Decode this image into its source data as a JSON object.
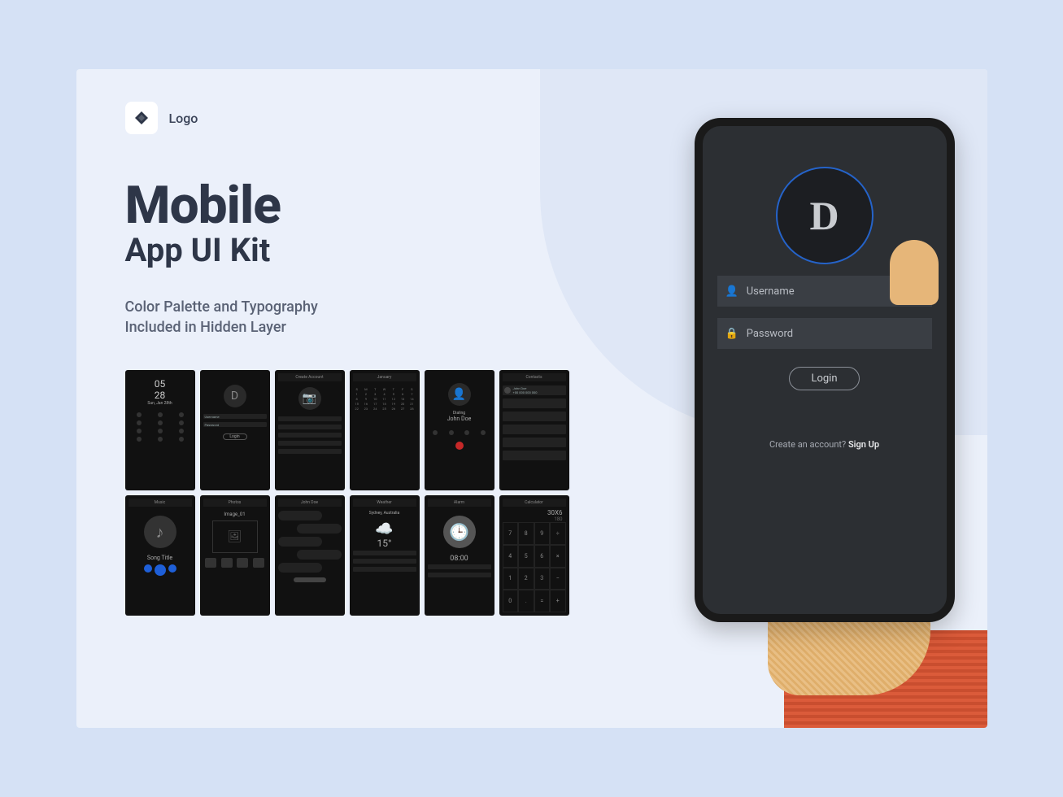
{
  "brand": {
    "name": "Logo"
  },
  "headline": {
    "line1": "Mobile",
    "line2": "App UI Kit"
  },
  "subtitle": {
    "line1": "Color Palette and Typography",
    "line2": "Included in Hidden Layer"
  },
  "phone": {
    "logo_letter": "D",
    "username_placeholder": "Username",
    "password_placeholder": "Password",
    "login_label": "Login",
    "signup_prompt": "Create an account?",
    "signup_action": "Sign Up"
  },
  "minis": {
    "lock": {
      "time": "05\n28",
      "date": "Sun, Jan 28th"
    },
    "login": {
      "logo": "D",
      "user": "Username",
      "pass": "Password",
      "btn": "Login"
    },
    "create": {
      "title": "Create Account"
    },
    "calendar": {
      "title": "January"
    },
    "dialing": {
      "label": "Dialing",
      "name": "John Doe"
    },
    "contacts": {
      "title": "Contacts",
      "name": "John Doe",
      "phone": "+00 000 000 000"
    },
    "music": {
      "title": "Music",
      "song": "Song Title"
    },
    "photos": {
      "title": "Photos",
      "img": "Image_01"
    },
    "chat": {
      "title": "John Doe"
    },
    "weather": {
      "title": "Weather",
      "city": "Sydney, Australia",
      "temp": "15°"
    },
    "alarm": {
      "title": "Alarm",
      "time": "08:00"
    },
    "calc": {
      "title": "Calculator",
      "display1": "30X6",
      "display2": "180"
    }
  }
}
